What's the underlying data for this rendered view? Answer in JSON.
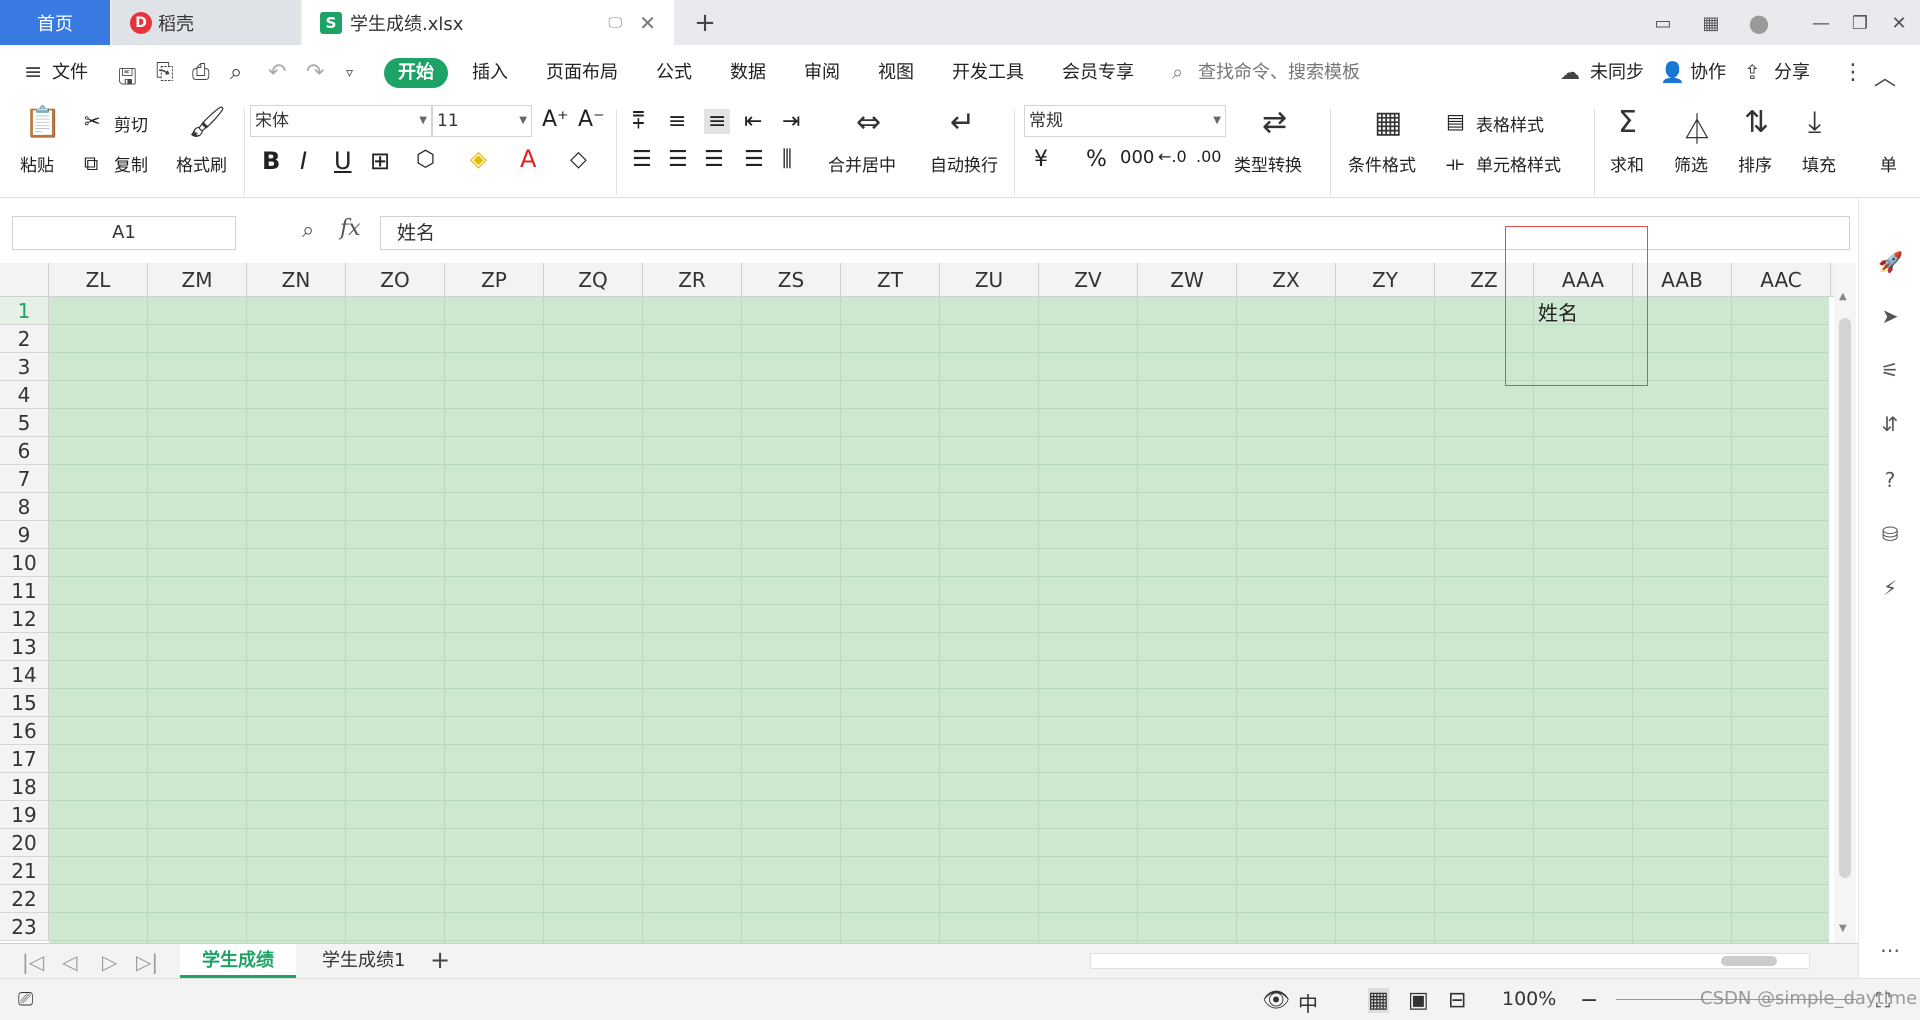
{
  "titlebar": {
    "tabs": [
      {
        "label": "首页"
      },
      {
        "label": "稻壳",
        "icon": "daoke-icon"
      },
      {
        "label": "学生成绩.xlsx",
        "icon": "wps-spreadsheet-icon"
      }
    ],
    "accent": "#3a7be3"
  },
  "menubar": {
    "file": "文件",
    "items": [
      "开始",
      "插入",
      "页面布局",
      "公式",
      "数据",
      "审阅",
      "视图",
      "开发工具",
      "会员专享"
    ],
    "search_placeholder": "查找命令、搜索模板",
    "sync": "未同步",
    "collab": "协作",
    "share": "分享",
    "active_color": "#1ea366"
  },
  "ribbon": {
    "paste": "粘贴",
    "cut": "剪切",
    "copy": "复制",
    "format_painter": "格式刷",
    "font_name": "宋体",
    "font_size": "11",
    "merge_center": "合并居中",
    "wrap_text": "自动换行",
    "number_format": "常规",
    "type_convert": "类型转换",
    "conditional_format": "条件格式",
    "table_style": "表格样式",
    "cell_style": "单元格样式",
    "sum": "求和",
    "filter": "筛选",
    "sort": "排序",
    "fill": "填充",
    "single": "单"
  },
  "formula": {
    "cell_ref": "A1",
    "fx": "fx",
    "content": "姓名"
  },
  "sheet": {
    "columns": [
      "ZL",
      "ZM",
      "ZN",
      "ZO",
      "ZP",
      "ZQ",
      "ZR",
      "ZS",
      "ZT",
      "ZU",
      "ZV",
      "ZW",
      "ZX",
      "ZY",
      "ZZ",
      "AAA",
      "AAB",
      "AAC"
    ],
    "rows": [
      "1",
      "2",
      "3",
      "4",
      "5",
      "6",
      "7",
      "8",
      "9",
      "10",
      "11",
      "12",
      "13",
      "14",
      "15",
      "16",
      "17",
      "18",
      "19",
      "20",
      "21",
      "22",
      "23"
    ],
    "cell_aaa1": "姓名",
    "cell_bg": "#cde8cf"
  },
  "sheettabs": {
    "tabs": [
      "学生成绩",
      "学生成绩1"
    ],
    "active": "学生成绩"
  },
  "statusbar": {
    "zoom": "100%",
    "watermark": "CSDN @simple_daytime"
  }
}
